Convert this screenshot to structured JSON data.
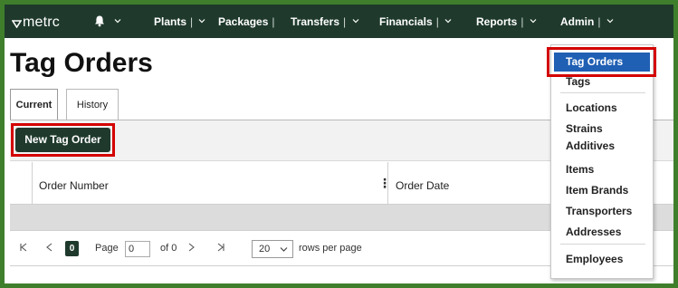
{
  "brand": {
    "logo_text": "metrc"
  },
  "nav": {
    "items": [
      {
        "label": "Plants",
        "sep": "|"
      },
      {
        "label": "Packages",
        "sep": "|"
      },
      {
        "label": "Transfers",
        "sep": "|"
      },
      {
        "label": "Financials",
        "sep": "|"
      },
      {
        "label": "Reports",
        "sep": "|"
      },
      {
        "label": "Admin",
        "sep": "|"
      }
    ]
  },
  "page": {
    "title": "Tag Orders"
  },
  "tabs": [
    {
      "label": "Current",
      "selected": true
    },
    {
      "label": "History",
      "selected": false
    }
  ],
  "toolbar": {
    "new_button_label": "New Tag Order"
  },
  "grid": {
    "columns": [
      "Order Number",
      "Order Date"
    ],
    "column_menu_glyph": "⋮",
    "rows": []
  },
  "pager": {
    "current_page_badge": "0",
    "page_label": "Page",
    "page_value": "0",
    "of_label": "of 0",
    "rows_per_page_value": "20",
    "rows_per_page_label": "rows per page"
  },
  "admin_menu": {
    "items": [
      {
        "label": "Tag Orders",
        "active": true
      },
      {
        "label": "Tags"
      },
      {
        "label": "Locations"
      },
      {
        "label": "Strains"
      },
      {
        "label": "Additives"
      },
      {
        "label": "Items"
      },
      {
        "label": "Item Brands"
      },
      {
        "label": "Transporters"
      },
      {
        "label": "Addresses"
      },
      {
        "label": "Employees"
      }
    ]
  },
  "colors": {
    "nav_bg": "#1f3a2d",
    "border_green": "#3f7f2c",
    "highlight_red": "#d40000",
    "menu_active": "#1f5fb4",
    "empty_row": "#dcdcdc"
  },
  "icons": [
    "bell-icon",
    "chevron-down-icon",
    "first-page-icon",
    "prev-page-icon",
    "next-page-icon",
    "last-page-icon",
    "column-menu-icon"
  ]
}
